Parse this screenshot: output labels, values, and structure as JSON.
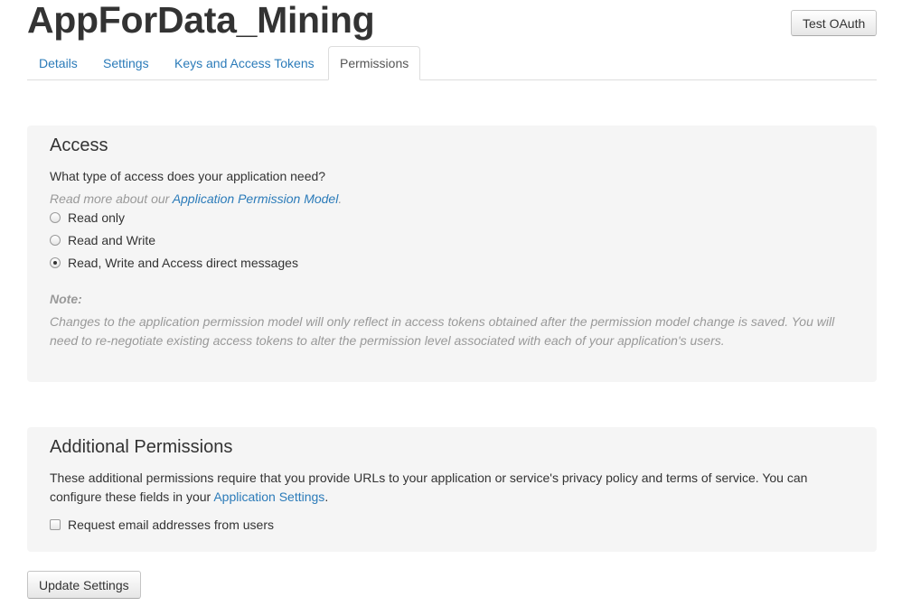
{
  "header": {
    "app_title": "AppForData_Mining",
    "test_oauth_label": "Test OAuth"
  },
  "tabs": [
    {
      "label": "Details",
      "active": false
    },
    {
      "label": "Settings",
      "active": false
    },
    {
      "label": "Keys and Access Tokens",
      "active": false
    },
    {
      "label": "Permissions",
      "active": true
    }
  ],
  "access": {
    "heading": "Access",
    "question": "What type of access does your application need?",
    "read_more_prefix": "Read more about our ",
    "read_more_link": "Application Permission Model",
    "read_more_suffix": ".",
    "options": [
      {
        "label": "Read only",
        "checked": false
      },
      {
        "label": "Read and Write",
        "checked": false
      },
      {
        "label": "Read, Write and Access direct messages",
        "checked": true
      }
    ],
    "note_label": "Note:",
    "note_text": "Changes to the application permission model will only reflect in access tokens obtained after the permission model change is saved. You will need to re-negotiate existing access tokens to alter the permission level associated with each of your application's users."
  },
  "additional": {
    "heading": "Additional Permissions",
    "description_prefix": "These additional permissions require that you provide URLs to your application or service's privacy policy and terms of service. You can configure these fields in your ",
    "settings_link": "Application Settings",
    "description_suffix": ".",
    "email_checkbox_label": "Request email addresses from users",
    "email_checked": false
  },
  "update_button_label": "Update Settings",
  "colors": {
    "link": "#2b7bb9",
    "panel_bg": "#f5f5f5",
    "muted_text": "#999999"
  }
}
